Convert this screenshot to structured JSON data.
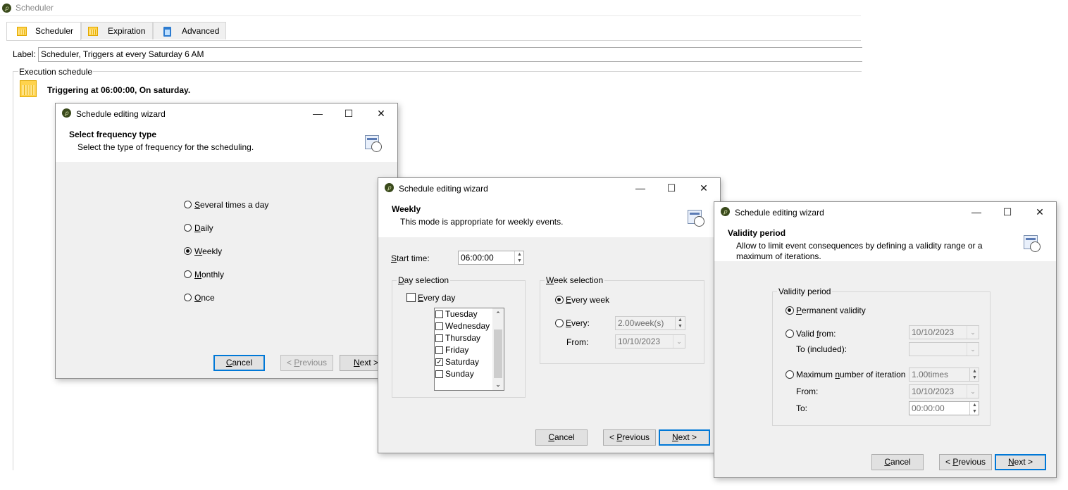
{
  "main": {
    "title": "Scheduler",
    "tabs": [
      {
        "label": "Scheduler",
        "icon": "calendar-icon"
      },
      {
        "label": "Expiration",
        "icon": "calendar-icon"
      },
      {
        "label": "Advanced",
        "icon": "clipboard-icon"
      }
    ],
    "label_caption": "Label:",
    "label_value": "Scheduler, Triggers at every Saturday 6 AM",
    "section": "Execution schedule",
    "trigger_text": "Triggering at 06:00:00, On saturday."
  },
  "window_controls": {
    "minimize": "—",
    "maximize": "☐",
    "close": "✕"
  },
  "wizard1": {
    "title": "Schedule editing wizard",
    "header_title": "Select frequency type",
    "header_subtitle": "Select the type of frequency for the scheduling.",
    "options": [
      {
        "first": "S",
        "rest": "everal times a day",
        "checked": false
      },
      {
        "first": "D",
        "rest": "aily",
        "checked": false
      },
      {
        "first": "W",
        "rest": "eekly",
        "checked": true
      },
      {
        "first": "M",
        "rest": "onthly",
        "checked": false
      },
      {
        "first": "O",
        "rest": "nce",
        "checked": false
      }
    ],
    "cancel": {
      "first": "C",
      "rest": "ancel"
    },
    "previous": {
      "pre": "< ",
      "first": "P",
      "rest": "revious"
    },
    "next": {
      "first": "N",
      "rest": "ext >"
    }
  },
  "wizard2": {
    "title": "Schedule editing wizard",
    "header_title": "Weekly",
    "header_subtitle": "This mode is appropriate for weekly events.",
    "start_time_label": {
      "first": "S",
      "rest": "tart time:"
    },
    "start_time_value": "06:00:00",
    "day_selection_legend": {
      "first": "D",
      "rest": "ay selection"
    },
    "every_day_label": {
      "first": "E",
      "rest": "very day"
    },
    "days": [
      {
        "label": "Tuesday",
        "checked": false
      },
      {
        "label": "Wednesday",
        "checked": false
      },
      {
        "label": "Thursday",
        "checked": false
      },
      {
        "label": "Friday",
        "checked": false
      },
      {
        "label": "Saturday",
        "checked": true
      },
      {
        "label": "Sunday",
        "checked": false
      }
    ],
    "week_selection_legend": {
      "first": "W",
      "rest": "eek selection"
    },
    "every_week_label": {
      "first": "E",
      "rest": "very week"
    },
    "every_label": {
      "first": "E",
      "rest": "very:"
    },
    "every_value": "2.00week(s)",
    "from_label": "From:",
    "from_value": "10/10/2023",
    "cancel": {
      "first": "C",
      "rest": "ancel"
    },
    "previous": {
      "pre": "< ",
      "first": "P",
      "rest": "revious"
    },
    "next": {
      "first": "N",
      "rest": "ext >"
    }
  },
  "wizard3": {
    "title": "Schedule editing wizard",
    "header_title": "Validity period",
    "header_subtitle_1": "Allow to limit event consequences by defining a validity range or a",
    "header_subtitle_2": "maximum of iterations.",
    "group_legend": "Validity period",
    "permanent_label": {
      "first": "P",
      "rest": "ermanent validity"
    },
    "valid_from_label": {
      "pre": "Valid ",
      "first": "f",
      "rest": "rom:"
    },
    "valid_from_value": "10/10/2023",
    "to_included_label": "To (included):",
    "to_included_value": "",
    "max_label": {
      "pre": "Maximum ",
      "first": "n",
      "rest": "umber of iteration"
    },
    "max_value": "1.00times",
    "from_label": "From:",
    "from_value": "10/10/2023",
    "to_label": "To:",
    "to_value": "00:00:00",
    "cancel": {
      "first": "C",
      "rest": "ancel"
    },
    "previous": {
      "pre": "< ",
      "first": "P",
      "rest": "revious"
    },
    "next": {
      "first": "N",
      "rest": "ext >"
    }
  }
}
